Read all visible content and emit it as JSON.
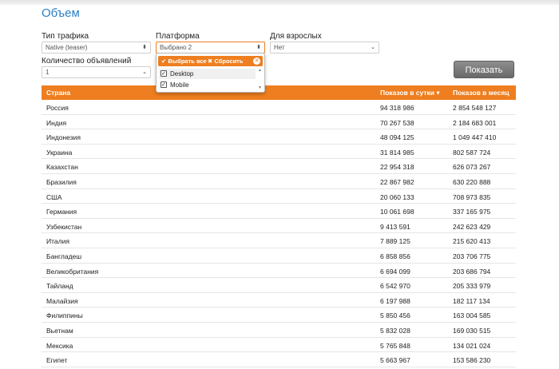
{
  "title": "Объем",
  "filters": {
    "traffic_type": {
      "label": "Тип трафика",
      "value": "Native (teaser)"
    },
    "platform": {
      "label": "Платформа",
      "value": "Выбрано 2"
    },
    "adult": {
      "label": "Для взрослых",
      "value": "Нет"
    },
    "ads_count": {
      "label": "Количество объявлений",
      "value": "1"
    }
  },
  "platform_dropdown": {
    "select_all": "Выбрать все",
    "reset": "Сбросить",
    "options": [
      {
        "label": "Desktop",
        "checked": true
      },
      {
        "label": "Mobile",
        "checked": true
      }
    ]
  },
  "show_button": "Показать",
  "table": {
    "headers": [
      "Страна",
      "Показов в сутки ▾",
      "Показов в месяц"
    ],
    "rows": [
      [
        "Россия",
        "94 318 986",
        "2 854 548 127"
      ],
      [
        "Индия",
        "70 267 538",
        "2 184 683 001"
      ],
      [
        "Индонезия",
        "48 094 125",
        "1 049 447 410"
      ],
      [
        "Украина",
        "31 814 985",
        "802 587 724"
      ],
      [
        "Казахстан",
        "22 954 318",
        "626 073 267"
      ],
      [
        "Бразилия",
        "22 867 982",
        "630 220 888"
      ],
      [
        "США",
        "20 060 133",
        "708 973 835"
      ],
      [
        "Германия",
        "10 061 698",
        "337 165 975"
      ],
      [
        "Узбекистан",
        "9 413 591",
        "242 623 429"
      ],
      [
        "Италия",
        "7 889 125",
        "215 620 413"
      ],
      [
        "Бангладеш",
        "6 858 856",
        "203 706 775"
      ],
      [
        "Великобритания",
        "6 694 099",
        "203 686 794"
      ],
      [
        "Тайланд",
        "6 542 970",
        "205 333 979"
      ],
      [
        "Малайзия",
        "6 197 988",
        "182 117 134"
      ],
      [
        "Филиппины",
        "5 850 456",
        "163 004 585"
      ],
      [
        "Вьетнам",
        "5 832 028",
        "169 030 515"
      ],
      [
        "Мексика",
        "5 765 848",
        "134 021 024"
      ],
      [
        "Египет",
        "5 663 967",
        "153 586 230"
      ]
    ]
  },
  "colors": {
    "accent": "#ee7e1f",
    "title": "#2b7fc4",
    "button": "#7a7a7a"
  }
}
